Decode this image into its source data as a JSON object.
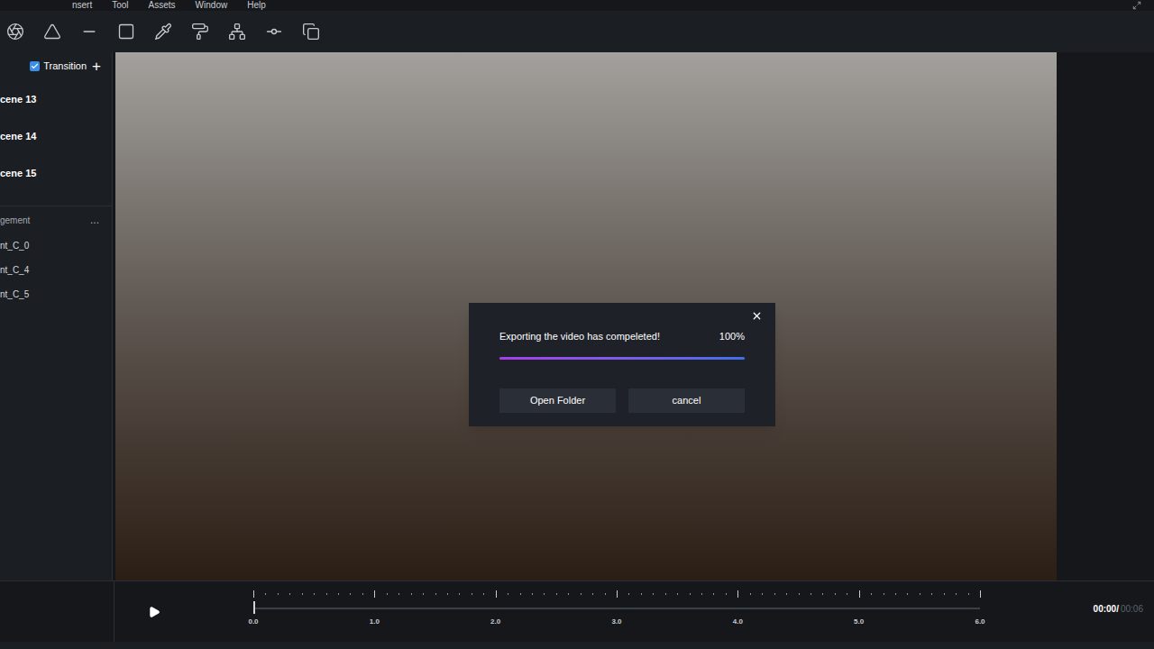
{
  "menu": [
    "nsert",
    "Tool",
    "Assets",
    "Window",
    "Help"
  ],
  "scenes_panel": {
    "transition": {
      "label": "Transition",
      "checked": true
    },
    "plus": "+",
    "scenes": [
      {
        "label": "cene 13",
        "selected": false
      },
      {
        "label": "cene 14",
        "selected": false
      },
      {
        "label": "cene 15",
        "selected": false
      }
    ]
  },
  "management": {
    "title": "gement",
    "more": "...",
    "items": [
      "nt_C_0",
      "nt_C_4",
      "nt_C_5"
    ]
  },
  "dialog": {
    "message": "Exporting the video has compeleted!",
    "percent": "100%",
    "level": 1,
    "buttons": [
      "Open Folder",
      "cancel"
    ]
  },
  "timeline": {
    "ticks": [
      "0.0",
      "1.0",
      "2.0",
      "3.0",
      "4.0",
      "5.0",
      "6.0"
    ],
    "playhead": 0,
    "current": "00:00/",
    "total": "00:06"
  }
}
